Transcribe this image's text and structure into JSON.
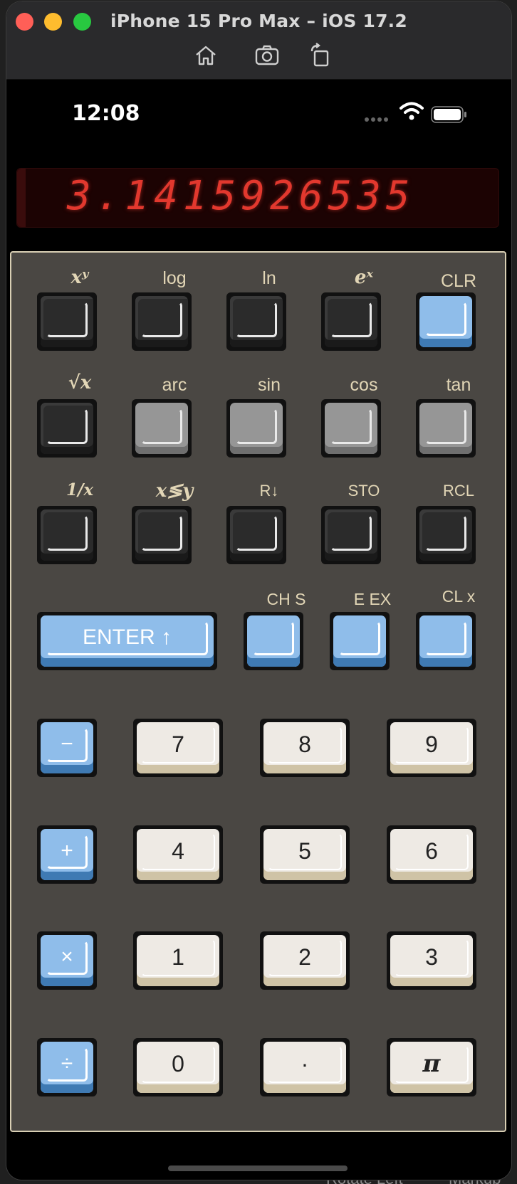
{
  "window": {
    "title": "iPhone 15 Pro Max – iOS 17.2",
    "toolbar_icons": [
      "home-icon",
      "screenshot-camera-icon",
      "rotate-icon"
    ]
  },
  "background_menu": {
    "rotate_left": "Rotate Left",
    "markup": "Markup"
  },
  "status_bar": {
    "time": "12:08",
    "icons": [
      "signal-dots-icon",
      "wifi-icon",
      "battery-icon"
    ]
  },
  "display": {
    "value": "3.1415926535",
    "color": "#e2382e"
  },
  "keys": {
    "row1": [
      {
        "label": "xʸ"
      },
      {
        "label": "log"
      },
      {
        "label": "ln"
      },
      {
        "label": "eˣ"
      },
      {
        "label": "CLR"
      }
    ],
    "row2": [
      {
        "label": "√x"
      },
      {
        "label": "arc"
      },
      {
        "label": "sin"
      },
      {
        "label": "cos"
      },
      {
        "label": "tan"
      }
    ],
    "row3": [
      {
        "label": "1/x"
      },
      {
        "label": "x≶y"
      },
      {
        "label": "R↓"
      },
      {
        "label": "STO"
      },
      {
        "label": "RCL"
      }
    ],
    "row4": {
      "enter": "ENTER ↑",
      "chs": "CH S",
      "eex": "E EX",
      "clx": "CL x"
    },
    "ops": [
      "−",
      "+",
      "×",
      "÷"
    ],
    "digits": {
      "r5": [
        "7",
        "8",
        "9"
      ],
      "r6": [
        "4",
        "5",
        "6"
      ],
      "r7": [
        "1",
        "2",
        "3"
      ],
      "r8": [
        "0",
        "·",
        "π"
      ]
    }
  },
  "colors": {
    "panel": "#4a4743",
    "label": "#e2d6b6",
    "blue_key": "#8fbdea",
    "gray_key": "#969696",
    "dark_key": "#2b2b2b",
    "cream_key": "#eeeae4"
  }
}
